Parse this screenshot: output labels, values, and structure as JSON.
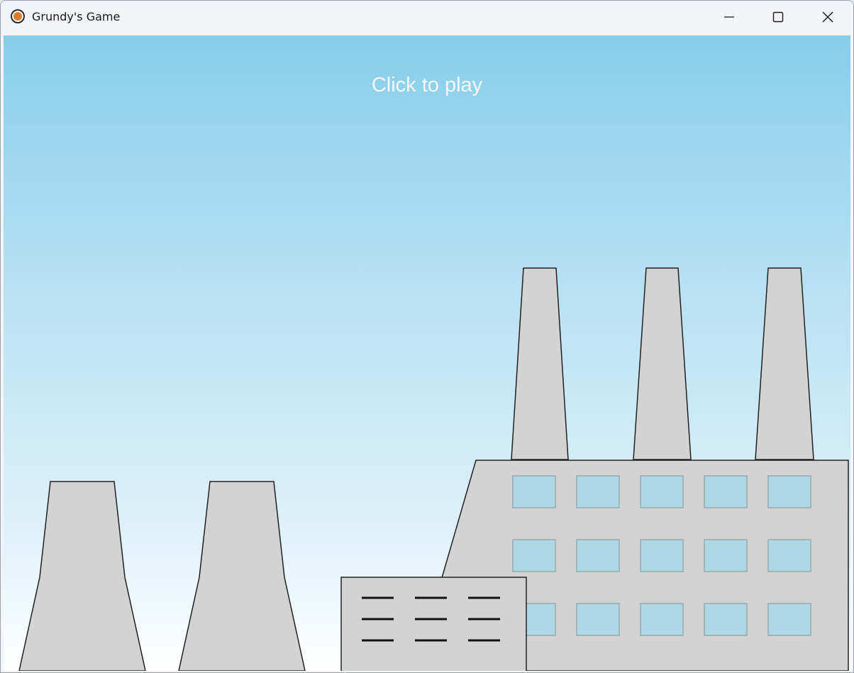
{
  "window": {
    "title": "Grundy's Game",
    "icons": {
      "app": "app-logo-icon",
      "minimize": "minimize-icon",
      "maximize": "maximize-icon",
      "close": "close-icon"
    }
  },
  "game": {
    "prompt": "Click to play"
  },
  "colors": {
    "sky_top": "#87ceeb",
    "sky_bottom": "#ffffff",
    "building_fill": "#d3d3d3",
    "outline": "#222222",
    "window_fill": "#add8e6",
    "window_border": "#9aa8ae",
    "app_icon_accent": "#e07b2a"
  }
}
